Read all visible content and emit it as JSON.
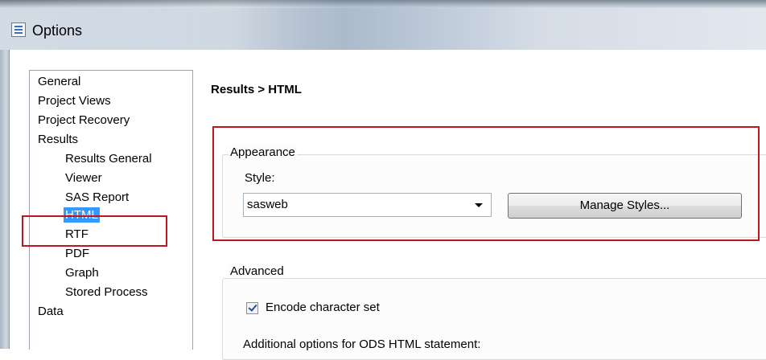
{
  "window": {
    "title": "Options"
  },
  "tree": {
    "items": [
      {
        "label": "General",
        "level": 0
      },
      {
        "label": "Project Views",
        "level": 0
      },
      {
        "label": "Project Recovery",
        "level": 0
      },
      {
        "label": "Results",
        "level": 0
      },
      {
        "label": "Results General",
        "level": 1
      },
      {
        "label": "Viewer",
        "level": 1
      },
      {
        "label": "SAS Report",
        "level": 1
      },
      {
        "label": "HTML",
        "level": 1,
        "selected": true
      },
      {
        "label": "RTF",
        "level": 1
      },
      {
        "label": "PDF",
        "level": 1
      },
      {
        "label": "Graph",
        "level": 1
      },
      {
        "label": "Stored Process",
        "level": 1
      },
      {
        "label": "Data",
        "level": 0
      }
    ]
  },
  "pane": {
    "title": "Results > HTML",
    "appearance": {
      "label": "Appearance",
      "style_label": "Style:",
      "style_value": "sasweb",
      "manage_button": "Manage Styles..."
    },
    "advanced": {
      "label": "Advanced",
      "encode_label": "Encode character set",
      "encode_checked": true,
      "additional_label": "Additional options for ODS HTML statement:"
    }
  },
  "colors": {
    "selection": "#3399ff",
    "highlight_box": "#c0151e"
  }
}
